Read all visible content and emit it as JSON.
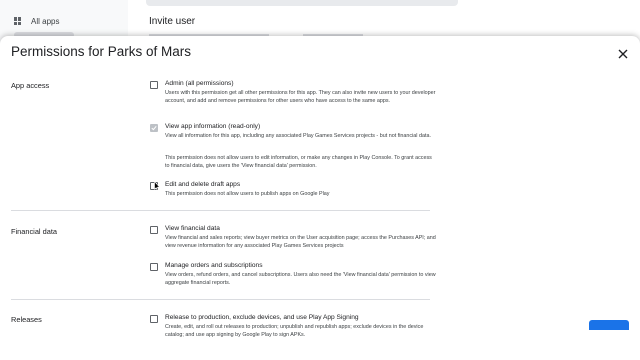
{
  "background": {
    "sidebar": {
      "all_apps_label": "All apps"
    },
    "main": {
      "title": "Invite user"
    }
  },
  "dialog": {
    "title": "Permissions for Parks of Mars",
    "sections": [
      {
        "label": "App access"
      },
      {
        "label": "Financial data"
      },
      {
        "label": "Releases"
      }
    ],
    "permissions": {
      "admin": {
        "title": "Admin (all permissions)",
        "checked": false,
        "description": "Users with this permission get all other permissions for this app. They can also invite new users to your developer account, and add and remove permissions for other users who have access to the same apps."
      },
      "view_app_info": {
        "title": "View app information (read-only)",
        "checked": true,
        "disabled": true,
        "description": "View all information for this app, including any associated Play Games Services projects - but not financial data.",
        "note": "This permission does not allow users to edit information, or make any changes in Play Console. To grant access to financial data, give users the 'View financial data' permission."
      },
      "edit_drafts": {
        "title": "Edit and delete draft apps",
        "checked": false,
        "description": "This permission does not allow users to publish apps on Google Play"
      },
      "view_financial": {
        "title": "View financial data",
        "checked": false,
        "description": "View financial and sales reports; view buyer metrics on the User acquisition page; access the Purchases API; and view revenue information for any associated Play Games Services projects"
      },
      "manage_orders": {
        "title": "Manage orders and subscriptions",
        "checked": false,
        "description": "View orders, refund orders, and cancel subscriptions. Users also need the 'View financial data' permission to view aggregate financial reports."
      },
      "release_production": {
        "title": "Release to production, exclude devices, and use Play App Signing",
        "checked": false,
        "description": "Create, edit, and roll out releases to production; unpublish and republish apps; exclude devices in the device catalog; and use app signing by Google Play to sign APKs."
      }
    }
  },
  "icons": {
    "close": "close-icon",
    "apps": "apps-grid-icon",
    "check": "check-icon",
    "cursor": "mouse-pointer-icon"
  },
  "colors": {
    "primary": "#1a73e8",
    "text": "#202124",
    "secondary_text": "#3c4043",
    "divider": "#dadce0"
  }
}
